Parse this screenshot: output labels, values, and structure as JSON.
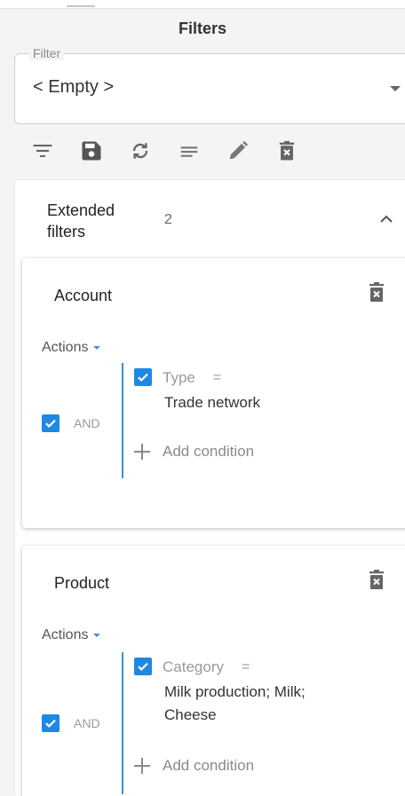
{
  "panel": {
    "title": "Filters"
  },
  "filter": {
    "legend": "Filter",
    "value": "< Empty >"
  },
  "toolbar": {
    "icons": [
      "filter-list-icon",
      "save-icon",
      "sync-icon",
      "lines-icon",
      "pencil-icon",
      "delete-icon"
    ]
  },
  "extended": {
    "title": "Extended filters",
    "count": "2"
  },
  "groups": [
    {
      "title": "Account",
      "actions_label": "Actions",
      "logic": "AND",
      "condition": {
        "field": "Type",
        "operator": "=",
        "value": "Trade network"
      },
      "add_condition": "Add condition"
    },
    {
      "title": "Product",
      "actions_label": "Actions",
      "logic": "AND",
      "condition": {
        "field": "Category",
        "operator": "=",
        "value": "Milk production; Milk; Cheese"
      },
      "add_condition": "Add condition"
    }
  ],
  "colors": {
    "accent": "#1e88e5",
    "line": "#3b8fd6",
    "icon": "#555555"
  }
}
